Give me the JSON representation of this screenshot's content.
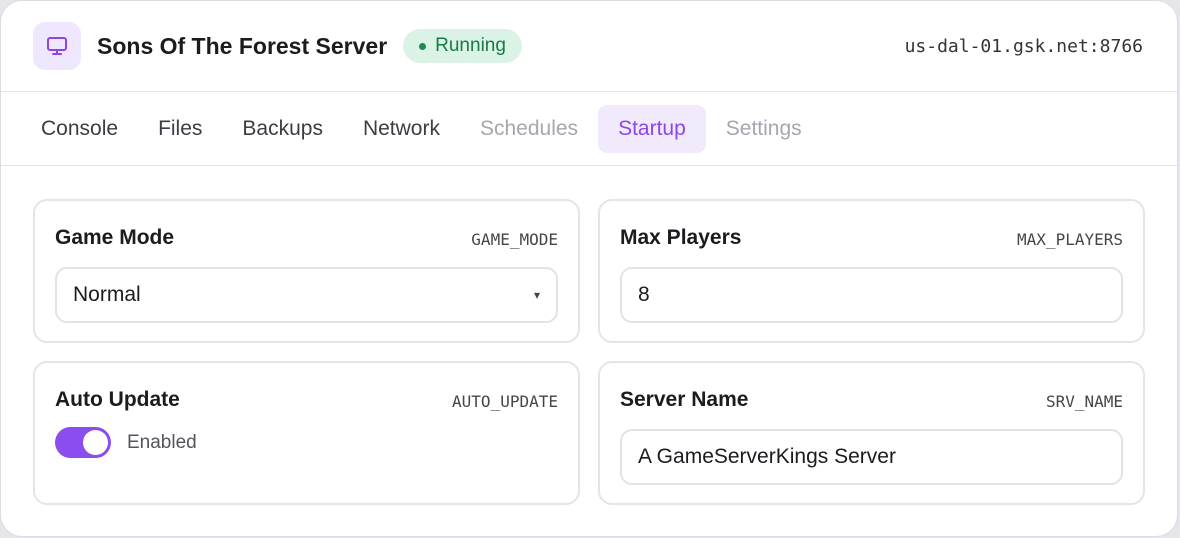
{
  "header": {
    "title": "Sons Of The Forest Server",
    "status": "Running",
    "address": "us-dal-01.gsk.net:8766",
    "icon": "monitor-icon",
    "accent_color": "#8c46e8",
    "status_color": "#187a46"
  },
  "tabs": [
    {
      "label": "Console",
      "state": "normal"
    },
    {
      "label": "Files",
      "state": "normal"
    },
    {
      "label": "Backups",
      "state": "normal"
    },
    {
      "label": "Network",
      "state": "normal"
    },
    {
      "label": "Schedules",
      "state": "disabled"
    },
    {
      "label": "Startup",
      "state": "active"
    },
    {
      "label": "Settings",
      "state": "disabled"
    }
  ],
  "variables": {
    "game_mode": {
      "label": "Game Mode",
      "key": "GAME_MODE",
      "value": "Normal"
    },
    "max_players": {
      "label": "Max Players",
      "key": "MAX_PLAYERS",
      "value": "8"
    },
    "auto_update": {
      "label": "Auto Update",
      "key": "AUTO_UPDATE",
      "value": "Enabled",
      "enabled": true
    },
    "server_name": {
      "label": "Server Name",
      "key": "SRV_NAME",
      "value": "A GameServerKings Server"
    }
  }
}
